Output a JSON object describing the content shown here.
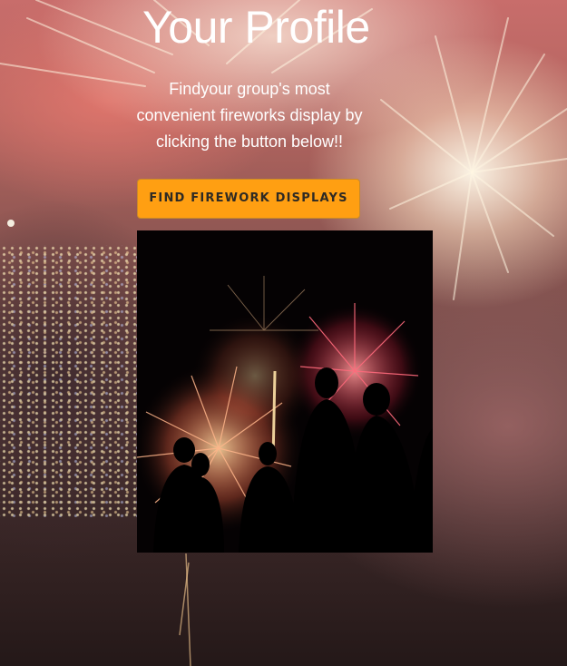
{
  "header": {
    "title": "Your Profile"
  },
  "intro": {
    "text": "Findyour group's most convenient fireworks display by clicking the button below!!"
  },
  "actions": {
    "find_button_label": "FIND FIREWORK DISPLAYS"
  },
  "colors": {
    "button_accent": "#ff9f12",
    "text": "#ffffff"
  },
  "images": {
    "background": "fireworks-over-city-background",
    "photo": "people-silhouettes-watching-fireworks"
  }
}
